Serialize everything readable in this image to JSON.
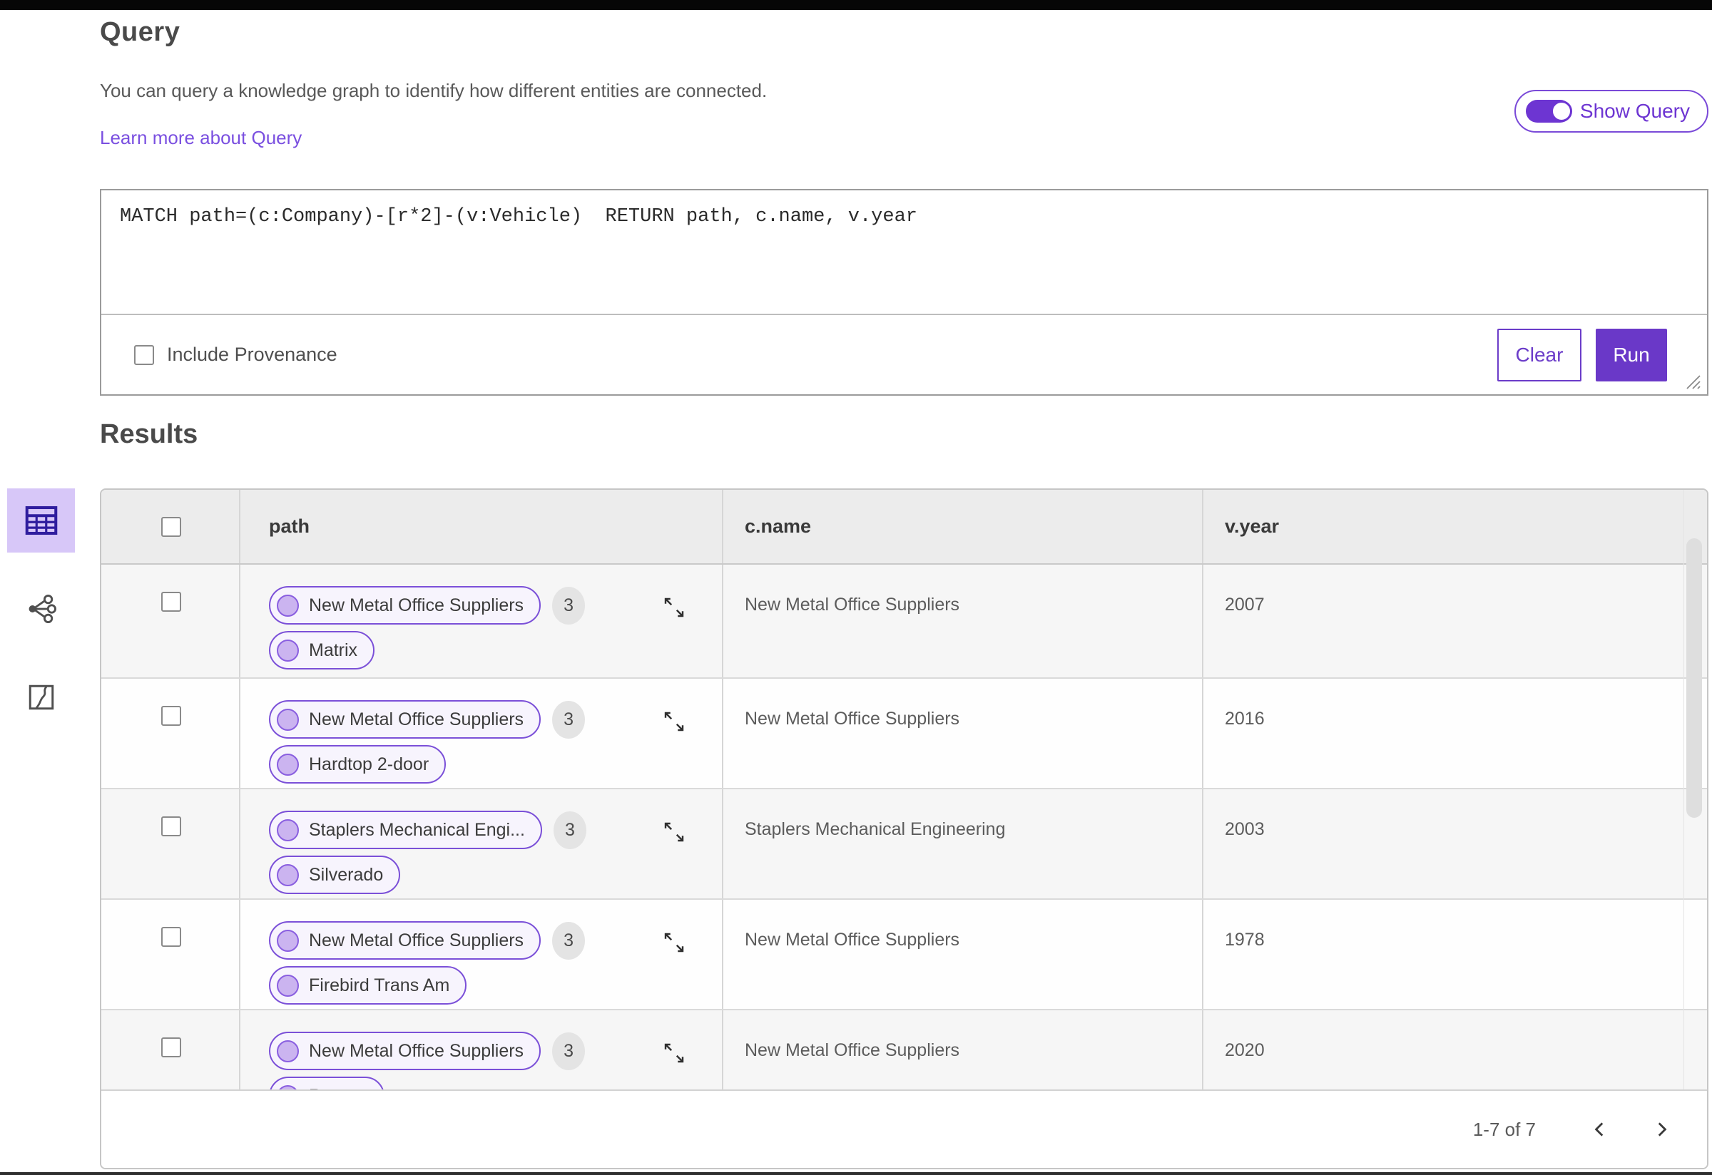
{
  "page": {
    "title": "Query",
    "description": "You can query a knowledge graph to identify how different entities are connected.",
    "learn_more_link": "Learn more about Query",
    "show_query_label": "Show Query",
    "show_query_state": "on"
  },
  "query_panel": {
    "query_text": "MATCH path=(c:Company)-[r*2]-(v:Vehicle)  RETURN path, c.name, v.year",
    "include_provenance_label": "Include Provenance",
    "include_provenance_checked": false,
    "clear_label": "Clear",
    "run_label": "Run"
  },
  "results": {
    "heading": "Results",
    "view_modes": [
      "table-view",
      "graph-view",
      "map-view"
    ],
    "active_view": "table-view",
    "columns": [
      "path",
      "c.name",
      "v.year"
    ],
    "rows": [
      {
        "path_nodes": [
          "New Metal Office Suppliers",
          "Matrix"
        ],
        "edge_count": "3",
        "c_name": "New Metal Office Suppliers",
        "v_year": "2007"
      },
      {
        "path_nodes": [
          "New Metal Office Suppliers",
          "Hardtop 2-door"
        ],
        "edge_count": "3",
        "c_name": "New Metal Office Suppliers",
        "v_year": "2016"
      },
      {
        "path_nodes": [
          "Staplers Mechanical Engi...",
          "Silverado"
        ],
        "edge_count": "3",
        "c_name": "Staplers Mechanical Engineering",
        "v_year": "2003"
      },
      {
        "path_nodes": [
          "New Metal Office Suppliers",
          "Firebird Trans Am"
        ],
        "edge_count": "3",
        "c_name": "New Metal Office Suppliers",
        "v_year": "1978"
      },
      {
        "path_nodes": [
          "New Metal Office Suppliers",
          "Ranger"
        ],
        "edge_count": "3",
        "c_name": "New Metal Office Suppliers",
        "v_year": "2020"
      }
    ],
    "pagination": {
      "range_label": "1-7 of 7"
    }
  },
  "colors": {
    "accent_purple": "#6a38c8",
    "toggle_purple": "#6d35d2",
    "link_purple": "#7a4fe0",
    "pill_border": "#7b50d8",
    "pill_background": "#f7f4fd",
    "pill_dot_fill": "#cbb4f0",
    "active_view_background": "#d7c7f8",
    "table_header_background": "#ececec",
    "zebra_row_background": "#f6f6f6",
    "badge_background": "#e4e4e4",
    "topbar_black": "#060606"
  }
}
